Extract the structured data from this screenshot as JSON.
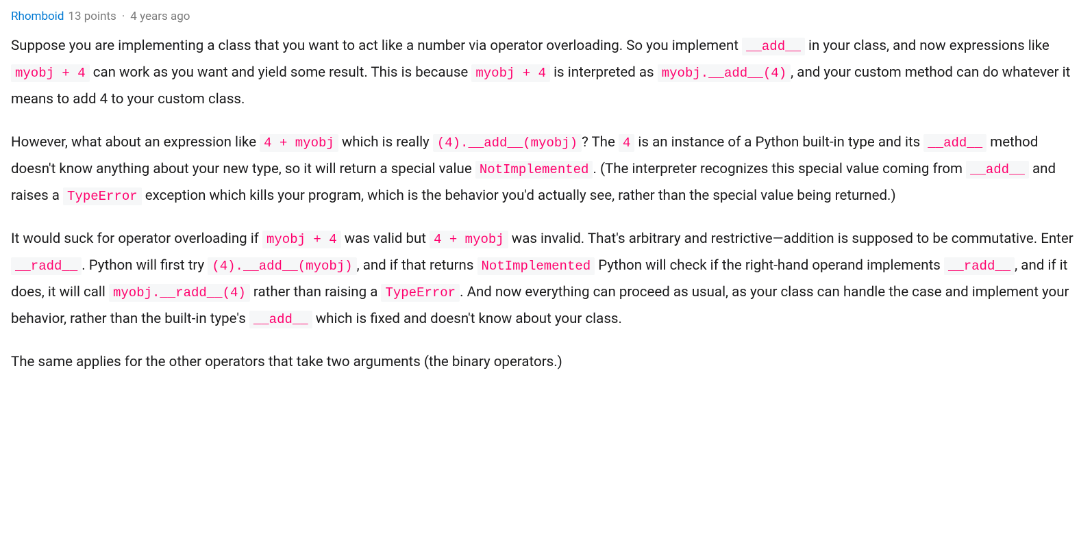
{
  "comment": {
    "author": "Rhomboid",
    "points": "13 points",
    "timestamp": "4 years ago",
    "separator": "·",
    "paragraphs": {
      "p1": {
        "t1": "Suppose you are implementing a class that you want to act like a number via operator overloading. So you implement ",
        "c1": "__add__",
        "t2": " in your class, and now expressions like ",
        "c2": "myobj + 4",
        "t3": " can work as you want and yield some result. This is because ",
        "c3": "myobj + 4",
        "t4": " is interpreted as ",
        "c4": "myobj.__add__(4)",
        "t5": ", and your custom method can do whatever it means to add 4 to your custom class."
      },
      "p2": {
        "t1": "However, what about an expression like ",
        "c1": "4 + myobj",
        "t2": " which is really ",
        "c2": "(4).__add__(myobj)",
        "t3": "? The ",
        "c3": "4",
        "t4": " is an instance of a Python built-in type and its ",
        "c4": "__add__",
        "t5": " method doesn't know anything about your new type, so it will return a special value ",
        "c5": "NotImplemented",
        "t6": ". (The interpreter recognizes this special value coming from ",
        "c6": "__add__",
        "t7": " and raises a ",
        "c7": "TypeError",
        "t8": " exception which kills your program, which is the behavior you'd actually see, rather than the special value being returned.)"
      },
      "p3": {
        "t1": "It would suck for operator overloading if ",
        "c1": "myobj + 4",
        "t2": " was valid but ",
        "c2": "4 + myobj",
        "t3": " was invalid. That's arbitrary and restrictive—addition is supposed to be commutative. Enter ",
        "c3": "__radd__",
        "t4": ". Python will first try ",
        "c4": "(4).__add__(myobj)",
        "t5": ", and if that returns ",
        "c5": "NotImplemented",
        "t6": " Python will check if the right-hand operand implements ",
        "c6": "__radd__",
        "t7": ", and if it does, it will call ",
        "c7": "myobj.__radd__(4)",
        "t8": " rather than raising a ",
        "c8": "TypeError",
        "t9": ". And now everything can proceed as usual, as your class can handle the case and implement your behavior, rather than the built-in type's ",
        "c9": "__add__",
        "t10": " which is fixed and doesn't know about your class."
      },
      "p4": {
        "t1": "The same applies for the other operators that take two arguments (the binary operators.)"
      }
    }
  }
}
